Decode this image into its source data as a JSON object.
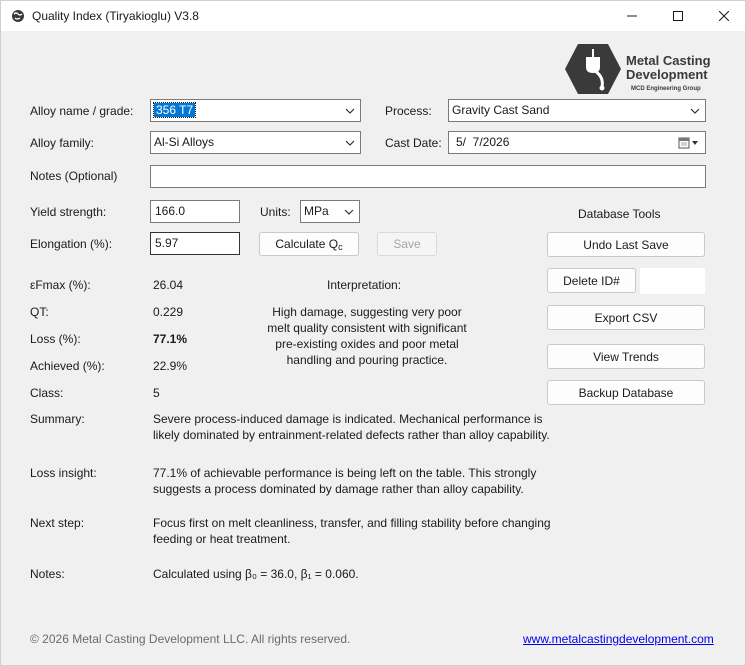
{
  "window": {
    "title": "Quality Index (Tiryakioglu) V3.8",
    "app_icon": "globe-icon"
  },
  "logo": {
    "name_line1": "Metal Casting",
    "name_line2": "Development",
    "subtitle": "MCD Engineering Group",
    "icon": "ladle-hexagon-icon",
    "color": "#3a3a3a"
  },
  "form": {
    "alloy_name_label": "Alloy name / grade:",
    "alloy_name_value": "356 T7",
    "alloy_family_label": "Alloy family:",
    "alloy_family_value": "Al-Si Alloys",
    "process_label": "Process:",
    "process_value": "Gravity Cast Sand",
    "cast_date_label": "Cast Date:",
    "cast_date_value": "5/  7/2026",
    "notes_label": "Notes (Optional)",
    "notes_value": "",
    "yield_label": "Yield strength:",
    "yield_value": "166.0",
    "units_label": "Units:",
    "units_value": "MPa",
    "elongation_label": "Elongation (%):",
    "elongation_value": "5.97",
    "calculate_label": "Calculate Q",
    "calculate_subscript": "c",
    "save_label": "Save"
  },
  "db_tools": {
    "heading": "Database Tools",
    "undo_label": "Undo Last Save",
    "delete_label": "Delete ID#",
    "delete_id_value": "",
    "export_label": "Export CSV",
    "trends_label": "View Trends",
    "backup_label": "Backup Database"
  },
  "results": {
    "efmax_label": "εFmax (%):",
    "efmax_value": "26.04",
    "qt_label": "QT:",
    "qt_value": "0.229",
    "loss_label": "Loss (%):",
    "loss_value": "77.1%",
    "achieved_label": "Achieved (%):",
    "achieved_value": "22.9%",
    "class_label": "Class:",
    "class_value": "5",
    "interpretation_label": "Interpretation:",
    "interpretation_lines": [
      "High damage, suggesting very poor",
      "melt quality consistent with significant",
      "pre-existing oxides and poor metal",
      "handling and pouring practice."
    ],
    "summary_label": "Summary:",
    "summary_lines": [
      "Severe process-induced damage is indicated. Mechanical performance is",
      "likely dominated by entrainment-related defects rather than alloy capability."
    ],
    "loss_insight_label": "Loss insight:",
    "loss_insight_lines": [
      "77.1% of achievable performance is being left on the table. This strongly",
      "suggests a process dominated by damage rather than alloy capability."
    ],
    "next_step_label": "Next step:",
    "next_step_lines": [
      "Focus first on melt cleanliness, transfer, and filling stability before changing",
      "feeding or heat treatment."
    ],
    "notes_label": "Notes:",
    "notes_value": "Calculated using β₀ = 36.0, β₁ = 0.060."
  },
  "footer": {
    "copyright": "© 2026 Metal Casting Development LLC. All rights reserved.",
    "link": "www.metalcastingdevelopment.com",
    "link_color": "#0000ee"
  }
}
